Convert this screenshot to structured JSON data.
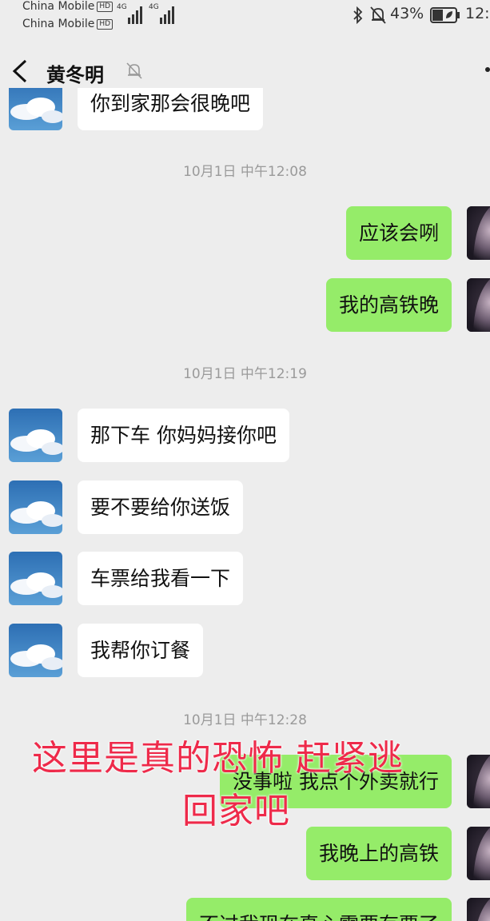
{
  "status_bar": {
    "carrier_1": "China Mobile",
    "carrier_2": "China Mobile",
    "hd_label": "HD",
    "net_1": "4G",
    "net_2": "4G",
    "battery_percent": "43%",
    "time": "12:"
  },
  "header": {
    "contact_name": "黄冬明"
  },
  "messages": [
    {
      "type": "text",
      "side": "in",
      "text": "你到家那会很晚吧"
    },
    {
      "type": "time",
      "text": "10月1日 中午12:08"
    },
    {
      "type": "text",
      "side": "out",
      "text": "应该会咧"
    },
    {
      "type": "text",
      "side": "out",
      "text": "我的高铁晚"
    },
    {
      "type": "time",
      "text": "10月1日 中午12:19"
    },
    {
      "type": "text",
      "side": "in",
      "text": "那下车 你妈妈接你吧"
    },
    {
      "type": "text",
      "side": "in",
      "text": "要不要给你送饭"
    },
    {
      "type": "text",
      "side": "in",
      "text": "车票给我看一下"
    },
    {
      "type": "text",
      "side": "in",
      "text": "我帮你订餐"
    },
    {
      "type": "time",
      "text": "10月1日 中午12:28"
    },
    {
      "type": "text",
      "side": "out",
      "text": "没事啦 我点个外卖就行"
    },
    {
      "type": "text",
      "side": "out",
      "text": "我晚上的高铁"
    },
    {
      "type": "text",
      "side": "out",
      "text": "不过我现在真心需要有票了"
    }
  ],
  "overlay": {
    "line_1": "这里是真的恐怖 赶紧逃",
    "line_2": "回家吧",
    "color": "#ee2a4a"
  },
  "colors": {
    "background": "#ededed",
    "outgoing_bubble": "#95ec69",
    "incoming_bubble": "#ffffff"
  }
}
